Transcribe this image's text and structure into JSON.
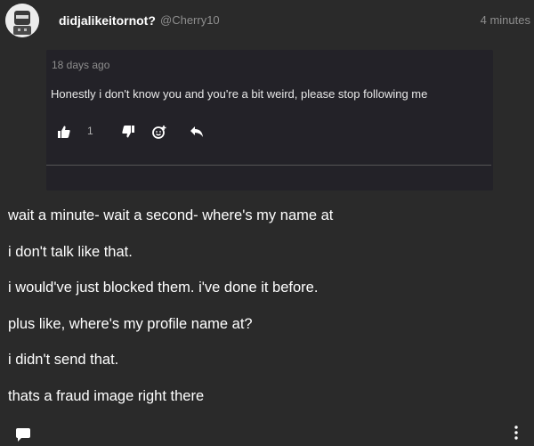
{
  "post": {
    "username": "didjalikeitornot?",
    "handle": "@Cherry10",
    "time": "4 minutes"
  },
  "quote": {
    "date": "18 days ago",
    "text": "Honestly i don't know you and you're a bit weird, please stop following me",
    "like_count": "1"
  },
  "messages": [
    "wait a minute- wait a second- where's my name at",
    "i don't talk like that.",
    "i would've just blocked them. i've done it before.",
    "plus like, where's my profile name at?",
    "i didn't send that.",
    "thats a fraud image right there"
  ],
  "icons": {
    "avatar": "avatar-image",
    "like": "thumbs-up-icon",
    "dislike": "thumbs-down-icon",
    "react": "add-reaction-icon",
    "reply": "reply-icon",
    "comment": "comment-bubble-icon",
    "more": "more-vertical-icon"
  },
  "colors": {
    "background": "#2a2a2a",
    "quote_background": "#232228",
    "muted_text": "#8e8e8e"
  }
}
